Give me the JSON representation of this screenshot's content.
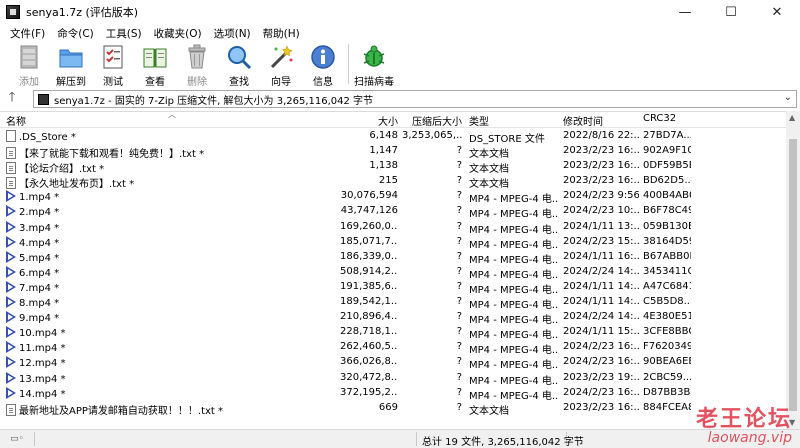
{
  "window": {
    "title": "senya1.7z (评估版本)",
    "buttons": {
      "minimize": "—",
      "maximize": "☐",
      "close": "✕"
    }
  },
  "menu": [
    "文件(F)",
    "命令(C)",
    "工具(S)",
    "收藏夹(O)",
    "选项(N)",
    "帮助(H)"
  ],
  "toolbar": [
    {
      "id": "add",
      "label": "添加",
      "icon": "add-archive-icon",
      "disabled": true
    },
    {
      "id": "extract",
      "label": "解压到",
      "icon": "extract-folder-icon",
      "disabled": false
    },
    {
      "id": "test",
      "label": "测试",
      "icon": "test-checklist-icon",
      "disabled": false
    },
    {
      "id": "view",
      "label": "查看",
      "icon": "view-book-icon",
      "disabled": false
    },
    {
      "id": "delete",
      "label": "删除",
      "icon": "trash-icon",
      "disabled": true
    },
    {
      "id": "find",
      "label": "查找",
      "icon": "magnifier-icon",
      "disabled": false
    },
    {
      "id": "wizard",
      "label": "向导",
      "icon": "wizard-wand-icon",
      "disabled": false
    },
    {
      "id": "info",
      "label": "信息",
      "icon": "info-icon",
      "disabled": false
    },
    {
      "id": "scan",
      "label": "扫描病毒",
      "icon": "virus-scan-icon",
      "disabled": false
    }
  ],
  "address": {
    "text": "senya1.7z - 固实的 7-Zip 压缩文件, 解包大小为 3,265,116,042 字节"
  },
  "columns": {
    "name": "名称",
    "size": "大小",
    "packed": "压缩后大小",
    "type": "类型",
    "modified": "修改时间",
    "crc": "CRC32"
  },
  "files": [
    {
      "icon": "file",
      "name": ".DS_Store *",
      "size": "6,148",
      "packed": "3,253,065,...",
      "type": "DS_STORE 文件",
      "modified": "2022/8/16 22:...",
      "crc": "27BD7A..."
    },
    {
      "icon": "doc",
      "name": "【来了就能下载和观看！纯免费！】.txt *",
      "size": "1,147",
      "packed": "?",
      "type": "文本文档",
      "modified": "2023/2/23 16:...",
      "crc": "902A9F10"
    },
    {
      "icon": "doc",
      "name": "【论坛介绍】.txt *",
      "size": "1,138",
      "packed": "?",
      "type": "文本文档",
      "modified": "2023/2/23 16:...",
      "crc": "0DF59B5B"
    },
    {
      "icon": "doc",
      "name": "【永久地址发布页】.txt *",
      "size": "215",
      "packed": "?",
      "type": "文本文档",
      "modified": "2023/2/23 16:...",
      "crc": "BD62D5..."
    },
    {
      "icon": "video",
      "name": "1.mp4 *",
      "size": "30,076,594",
      "packed": "?",
      "type": "MP4 - MPEG-4 电...",
      "modified": "2024/2/23 9:56",
      "crc": "400B4AB0"
    },
    {
      "icon": "video",
      "name": "2.mp4 *",
      "size": "43,747,126",
      "packed": "?",
      "type": "MP4 - MPEG-4 电...",
      "modified": "2024/2/23 10:...",
      "crc": "B6F78C49"
    },
    {
      "icon": "video",
      "name": "3.mp4 *",
      "size": "169,260,0...",
      "packed": "?",
      "type": "MP4 - MPEG-4 电...",
      "modified": "2024/1/11 13:...",
      "crc": "059B130E"
    },
    {
      "icon": "video",
      "name": "4.mp4 *",
      "size": "185,071,7...",
      "packed": "?",
      "type": "MP4 - MPEG-4 电...",
      "modified": "2024/2/23 15:...",
      "crc": "38164D59"
    },
    {
      "icon": "video",
      "name": "5.mp4 *",
      "size": "186,339,0...",
      "packed": "?",
      "type": "MP4 - MPEG-4 电...",
      "modified": "2024/1/11 16:...",
      "crc": "B67ABB0E"
    },
    {
      "icon": "video",
      "name": "6.mp4 *",
      "size": "508,914,2...",
      "packed": "?",
      "type": "MP4 - MPEG-4 电...",
      "modified": "2024/2/24 14:...",
      "crc": "3453411C"
    },
    {
      "icon": "video",
      "name": "7.mp4 *",
      "size": "191,385,6...",
      "packed": "?",
      "type": "MP4 - MPEG-4 电...",
      "modified": "2024/1/11 14:...",
      "crc": "A47C6841"
    },
    {
      "icon": "video",
      "name": "8.mp4 *",
      "size": "189,542,1...",
      "packed": "?",
      "type": "MP4 - MPEG-4 电...",
      "modified": "2024/1/11 14:...",
      "crc": "C5B5D8..."
    },
    {
      "icon": "video",
      "name": "9.mp4 *",
      "size": "210,896,4...",
      "packed": "?",
      "type": "MP4 - MPEG-4 电...",
      "modified": "2024/2/24 14:...",
      "crc": "4E380E51"
    },
    {
      "icon": "video",
      "name": "10.mp4 *",
      "size": "228,718,1...",
      "packed": "?",
      "type": "MP4 - MPEG-4 电...",
      "modified": "2024/1/11 15:...",
      "crc": "3CFE8BBC"
    },
    {
      "icon": "video",
      "name": "11.mp4 *",
      "size": "262,460,5...",
      "packed": "?",
      "type": "MP4 - MPEG-4 电...",
      "modified": "2024/2/23 16:...",
      "crc": "F7620349"
    },
    {
      "icon": "video",
      "name": "12.mp4 *",
      "size": "366,026,8...",
      "packed": "?",
      "type": "MP4 - MPEG-4 电...",
      "modified": "2024/2/23 16:...",
      "crc": "90BEA6EE"
    },
    {
      "icon": "video",
      "name": "13.mp4 *",
      "size": "320,472,8...",
      "packed": "?",
      "type": "MP4 - MPEG-4 电...",
      "modified": "2023/2/23 19:...",
      "crc": "2CBC59..."
    },
    {
      "icon": "video",
      "name": "14.mp4 *",
      "size": "372,195,2...",
      "packed": "?",
      "type": "MP4 - MPEG-4 电...",
      "modified": "2024/2/23 16:...",
      "crc": "D87BB3BC"
    },
    {
      "icon": "doc",
      "name": "最新地址及APP请发邮箱自动获取！！！.txt *",
      "size": "669",
      "packed": "?",
      "type": "文本文档",
      "modified": "2023/2/23 16:...",
      "crc": "884FCEA8"
    }
  ],
  "status": {
    "summary": "总计 19 文件, 3,265,116,042 字节"
  },
  "watermark": {
    "line1": "老王论坛",
    "line2": "laowang.vip"
  }
}
